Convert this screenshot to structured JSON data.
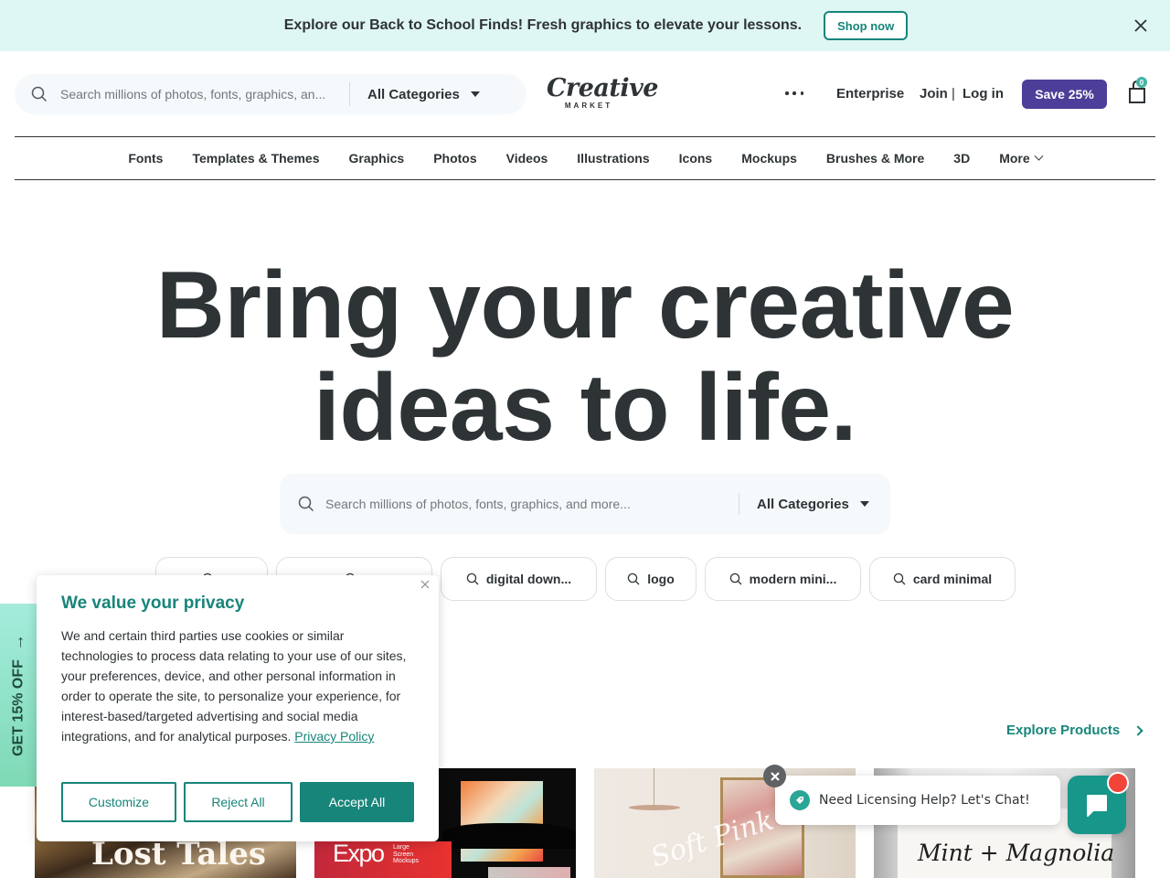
{
  "promo_bar": {
    "text": "Explore our Back to School Finds! Fresh graphics to elevate your lessons.",
    "button_label": "Shop now",
    "close_icon": "close-icon"
  },
  "header": {
    "search": {
      "placeholder": "Search millions of photos, fonts, graphics, an...",
      "value": "",
      "icon": "search-icon"
    },
    "category_select": "All Categories",
    "logo": {
      "word": "Creative",
      "sub": "MARKET"
    },
    "more_icon": "ellipsis-icon",
    "links": {
      "enterprise": "Enterprise",
      "join": "Join",
      "separator": "|",
      "login": "Log in"
    },
    "save_button": "Save 25%",
    "cart": {
      "icon": "shopping-bag-icon",
      "count": "0"
    }
  },
  "category_nav": {
    "items": [
      "Fonts",
      "Templates & Themes",
      "Graphics",
      "Photos",
      "Videos",
      "Illustrations",
      "Icons",
      "Mockups",
      "Brushes & More",
      "3D",
      "More"
    ]
  },
  "hero": {
    "title_line1": "Bring your creative",
    "title_line2": "ideas to life.",
    "search": {
      "placeholder": "Search millions of photos, fonts, graphics, and more...",
      "value": "",
      "category": "All Categories"
    },
    "chips": [
      "",
      "",
      "digital down...",
      "logo",
      "modern mini...",
      "card minimal"
    ]
  },
  "products": {
    "explore_label": "Explore Products",
    "cards": [
      {
        "title": "Lost Tales"
      },
      {
        "title": "Expo",
        "subtitle": "Large Screen Mockups"
      },
      {
        "title": "Soft Pink"
      },
      {
        "title": "Mint + Magnolia"
      }
    ]
  },
  "side_tab": {
    "label": "GET 15% OFF",
    "icon": "arrow-up-icon"
  },
  "cookie_banner": {
    "title": "We value your privacy",
    "body": "We and certain third parties use cookies or similar technologies to process data relating to your use of our sites, your preferences, device, and other personal information in order to operate the site, to personalize your experience, for interest-based/targeted advertising and social media integrations, and for analytical purposes.",
    "policy_link": "Privacy Policy",
    "buttons": {
      "customize": "Customize",
      "reject": "Reject All",
      "accept": "Accept All"
    }
  },
  "chat": {
    "message": "Need Licensing Help? Let's Chat!",
    "has_unread": true
  },
  "colors": {
    "brand_teal": "#17857a",
    "promo_bg": "#dff7f3",
    "save_purple": "#4d3e99",
    "text_dark": "#2e3336",
    "chat_teal": "#17968a",
    "notification_red": "#f24438"
  }
}
